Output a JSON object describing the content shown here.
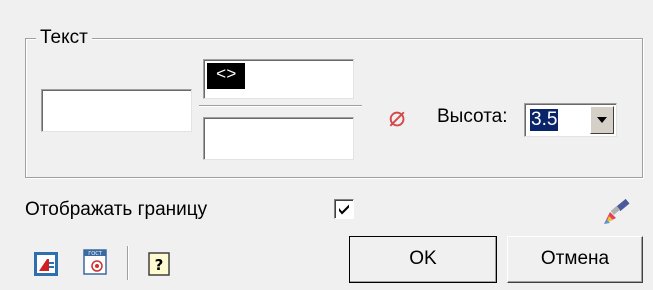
{
  "group": {
    "title": "Текст"
  },
  "text_fields": {
    "left_value": "",
    "top_value": "<>",
    "bottom_value": ""
  },
  "diameter_symbol": "⌀",
  "height": {
    "label": "Высота:",
    "selected": "3.5"
  },
  "show_border": {
    "label": "Отображать границу",
    "checked": true
  },
  "buttons": {
    "ok": "OK",
    "cancel": "Отмена"
  },
  "icons": {
    "brush": "brush-icon",
    "style": "text-style-icon",
    "gost": "gost-stamp-icon",
    "help": "help-icon"
  },
  "colors": {
    "diameter": "#d24a4a",
    "selection": "#0a246a"
  }
}
